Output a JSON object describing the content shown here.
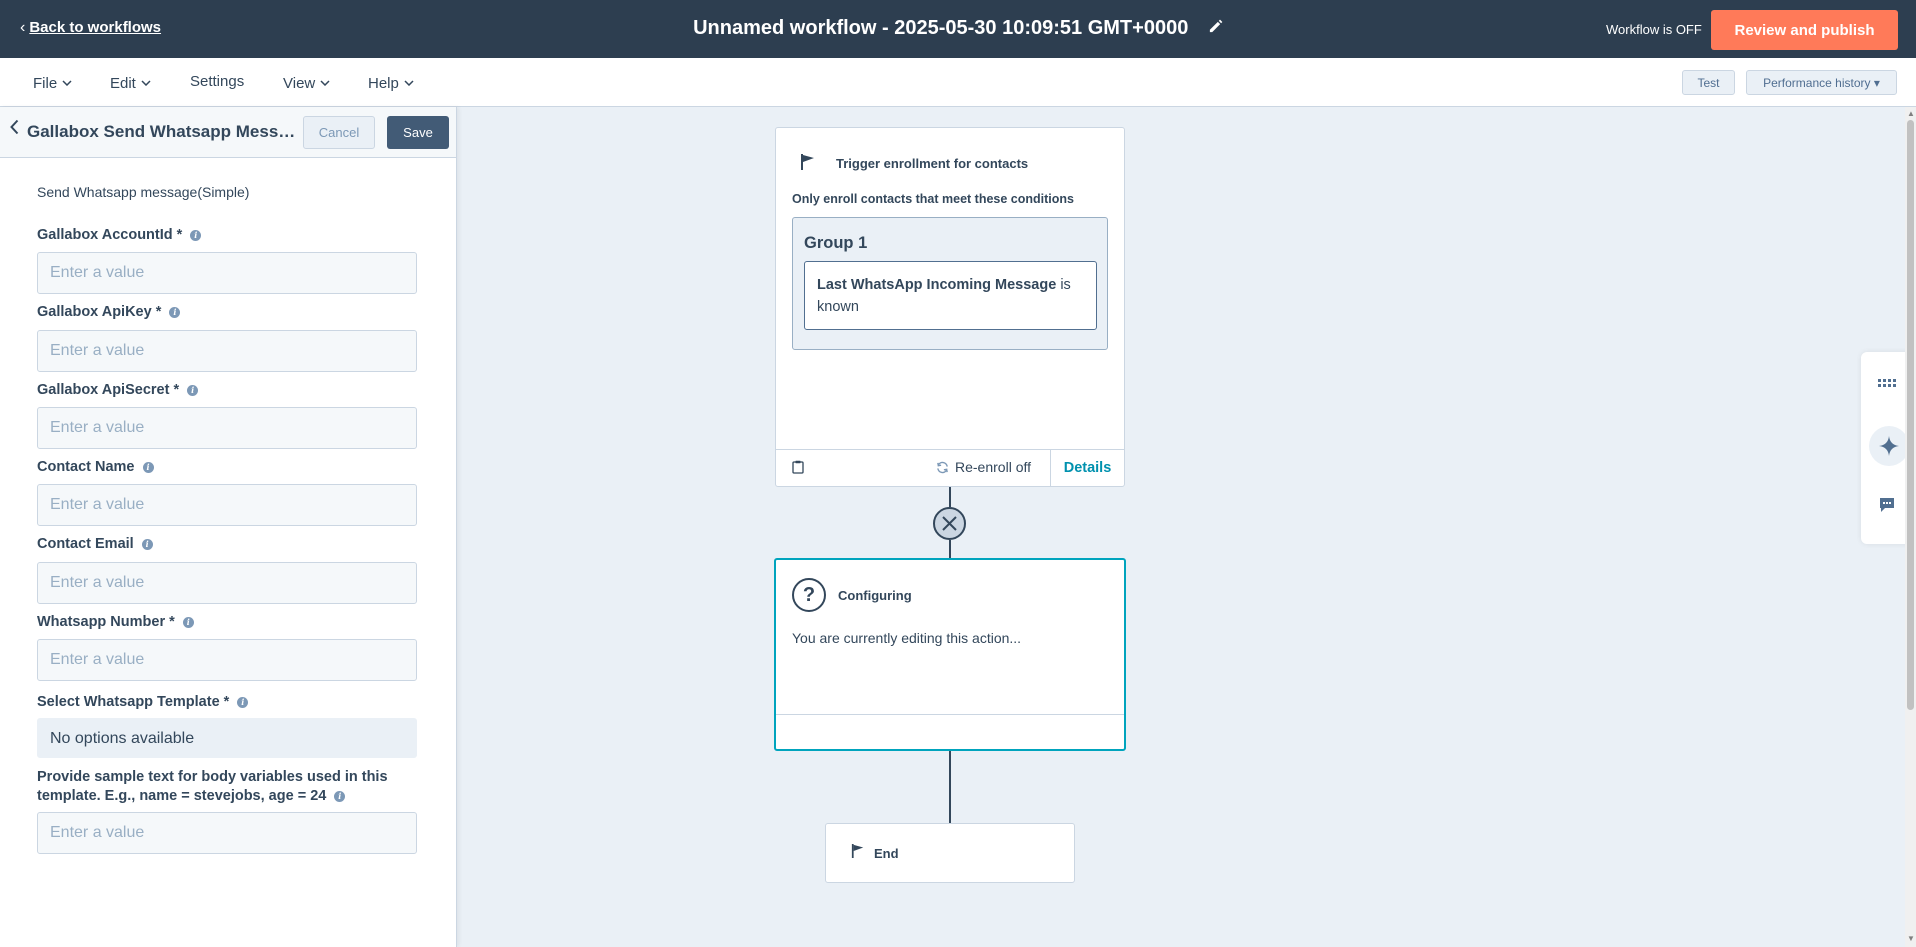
{
  "header": {
    "back_label": "Back to workflows",
    "title": "Unnamed workflow - 2025-05-30 10:09:51 GMT+0000",
    "status": "Workflow is OFF",
    "publish_label": "Review and publish",
    "accent_color": "#ff7a59",
    "bg_color": "#2d3e50"
  },
  "menu": {
    "items": [
      "File",
      "Edit",
      "Settings",
      "View",
      "Help"
    ],
    "test_label": "Test",
    "history_label": "Performance history"
  },
  "panel": {
    "title": "Gallabox Send Whatsapp Message",
    "title_display": "Gallabox Send Whatsapp Messa...",
    "cancel_label": "Cancel",
    "save_label": "Save",
    "subtitle": "Send Whatsapp message(Simple)",
    "fields": [
      {
        "label": "Gallabox AccountId *",
        "placeholder": "Enter a value"
      },
      {
        "label": "Gallabox ApiKey *",
        "placeholder": "Enter a value"
      },
      {
        "label": "Gallabox ApiSecret *",
        "placeholder": "Enter a value"
      },
      {
        "label": "Contact Name",
        "placeholder": "Enter a value"
      },
      {
        "label": "Contact Email",
        "placeholder": "Enter a value"
      },
      {
        "label": "Whatsapp Number *",
        "placeholder": "Enter a value"
      }
    ],
    "template": {
      "label": "Select Whatsapp Template *",
      "value": "No options available"
    },
    "sample": {
      "label": "Provide sample text for body variables used in this template. E.g., name = stevejobs, age = 24",
      "placeholder": "Enter a value"
    }
  },
  "canvas": {
    "trigger": {
      "title": "Trigger enrollment for contacts",
      "condition": "Only enroll contacts that meet these conditions",
      "group_title": "Group 1",
      "filter_property": "Last WhatsApp Incoming Message",
      "filter_operator": "is known",
      "reenroll": "Re-enroll off",
      "details": "Details"
    },
    "config": {
      "title": "Configuring",
      "text": "You are currently editing this action..."
    },
    "end": {
      "title": "End"
    }
  },
  "icons": [
    "chevron-left-icon",
    "pencil-icon",
    "caret-down-icon",
    "info-icon",
    "flag-icon",
    "clipboard-icon",
    "refresh-icon",
    "close-icon",
    "question-icon",
    "grid-icon",
    "sparkle-icon",
    "chat-icon"
  ]
}
